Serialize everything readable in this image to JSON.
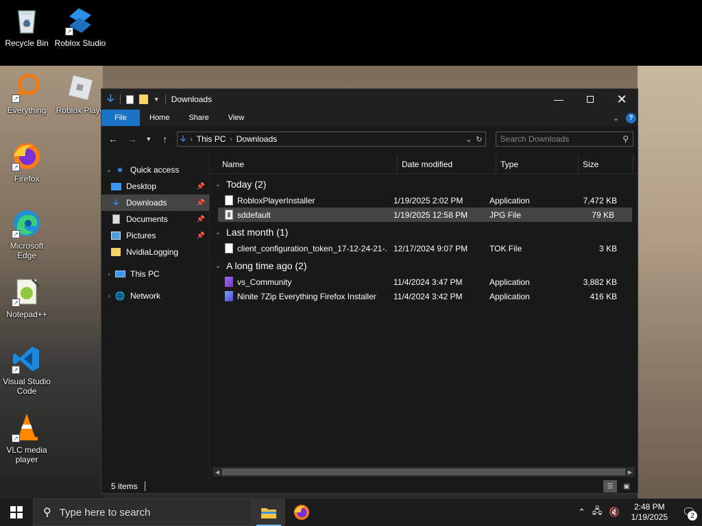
{
  "desktop": {
    "icons": [
      {
        "label": "Recycle Bin",
        "icon": "recycle-bin-icon"
      },
      {
        "label": "Roblox Studio",
        "icon": "roblox-studio-icon"
      },
      {
        "label": "Everything",
        "icon": "everything-search-icon"
      },
      {
        "label": "Roblox Playe",
        "icon": "roblox-player-icon"
      },
      {
        "label": "Firefox",
        "icon": "firefox-icon"
      },
      {
        "label": "Microsoft Edge",
        "icon": "edge-icon"
      },
      {
        "label": "Notepad++",
        "icon": "notepadpp-icon"
      },
      {
        "label": "Visual Studio Code",
        "icon": "vscode-icon"
      },
      {
        "label": "VLC media player",
        "icon": "vlc-icon"
      }
    ]
  },
  "explorer": {
    "title": "Downloads",
    "ribbon_tabs": [
      "File",
      "Home",
      "Share",
      "View"
    ],
    "address": {
      "crumbs": [
        "This PC",
        "Downloads"
      ]
    },
    "search_placeholder": "Search Downloads",
    "nav": {
      "quick_access": "Quick access",
      "pinned": [
        "Desktop",
        "Downloads",
        "Documents",
        "Pictures"
      ],
      "other": "NvidiaLogging",
      "this_pc": "This PC",
      "network": "Network"
    },
    "columns": [
      "Name",
      "Date modified",
      "Type",
      "Size"
    ],
    "groups": [
      {
        "label": "Today (2)",
        "files": [
          {
            "name": "RobloxPlayerInstaller",
            "date": "1/19/2025 2:02 PM",
            "type": "Application",
            "size": "7,472 KB",
            "icon": "file-icon"
          },
          {
            "name": "sddefault",
            "date": "1/19/2025 12:58 PM",
            "type": "JPG File",
            "size": "79 KB",
            "icon": "image-file-icon"
          }
        ]
      },
      {
        "label": "Last month (1)",
        "files": [
          {
            "name": "client_configuration_token_17-12-24-21-...",
            "date": "12/17/2024 9:07 PM",
            "type": "TOK File",
            "size": "3 KB",
            "icon": "file-icon"
          }
        ]
      },
      {
        "label": "A long time ago (2)",
        "files": [
          {
            "name": "vs_Community",
            "date": "11/4/2024 3:47 PM",
            "type": "Application",
            "size": "3,882 KB",
            "icon": "visual-studio-icon"
          },
          {
            "name": "Ninite 7Zip Everything Firefox Installer",
            "date": "11/4/2024 3:42 PM",
            "type": "Application",
            "size": "416 KB",
            "icon": "ninite-icon"
          }
        ]
      }
    ],
    "status": "5 items"
  },
  "taskbar": {
    "search_placeholder": "Type here to search",
    "time": "2:48 PM",
    "date": "1/19/2025",
    "notification_count": "2"
  },
  "colors": {
    "accent": "#1a73c7",
    "window_bg": "#191919",
    "selection": "#444444"
  }
}
